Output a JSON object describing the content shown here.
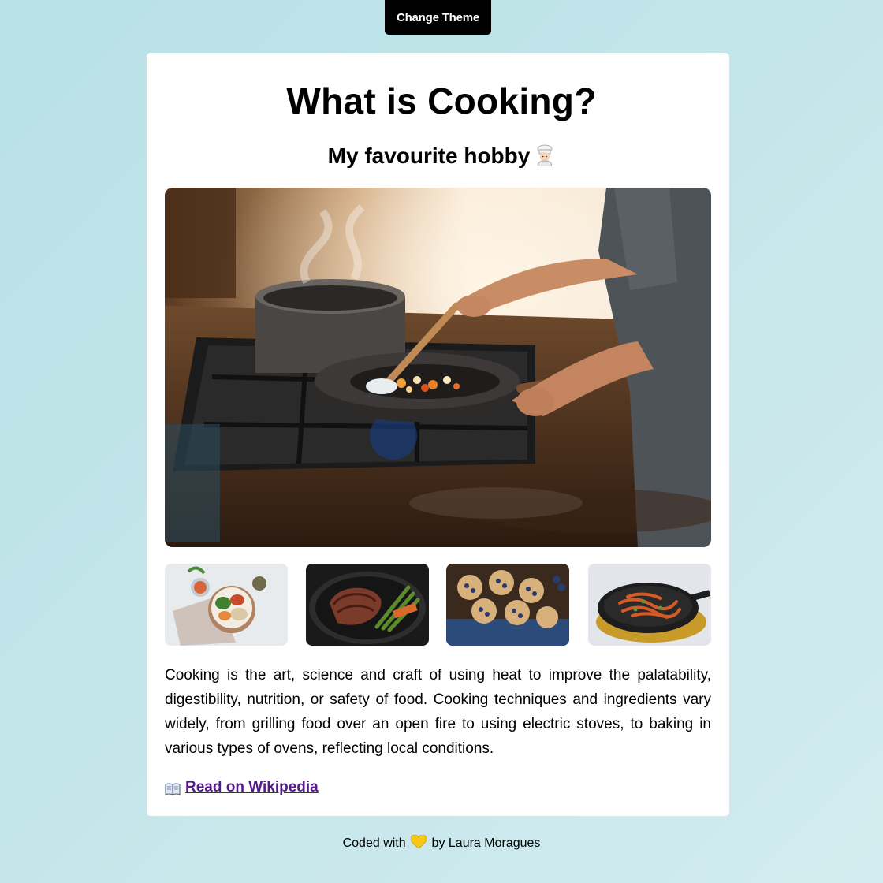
{
  "header": {
    "theme_button_label": "Change Theme"
  },
  "card": {
    "title": "What is Cooking?",
    "subtitle": "My favourite hobby",
    "subtitle_icon": "chef-emoji-icon",
    "hero_image": "cooking-on-stove-image",
    "thumbnails": [
      {
        "name": "healthy-bowl-thumbnail"
      },
      {
        "name": "steak-asparagus-thumbnail"
      },
      {
        "name": "blueberry-muffins-thumbnail"
      },
      {
        "name": "pasta-skillet-thumbnail"
      }
    ],
    "description": "Cooking is the art, science and craft of using heat to improve the palatability, digestibility, nutrition, or safety of food. Cooking techniques and ingredients vary widely, from grilling food over an open fire to using electric stoves, to baking in various types of ovens, reflecting local conditions.",
    "link_label": "Read on Wikipedia",
    "link_icon": "book-icon"
  },
  "footer": {
    "prefix": "Coded with",
    "icon": "yellow-heart-icon",
    "suffix": "by Laura Moragues"
  },
  "colors": {
    "background": "#c4e6ea",
    "card": "#ffffff",
    "button": "#000000",
    "link": "#551a8b"
  }
}
